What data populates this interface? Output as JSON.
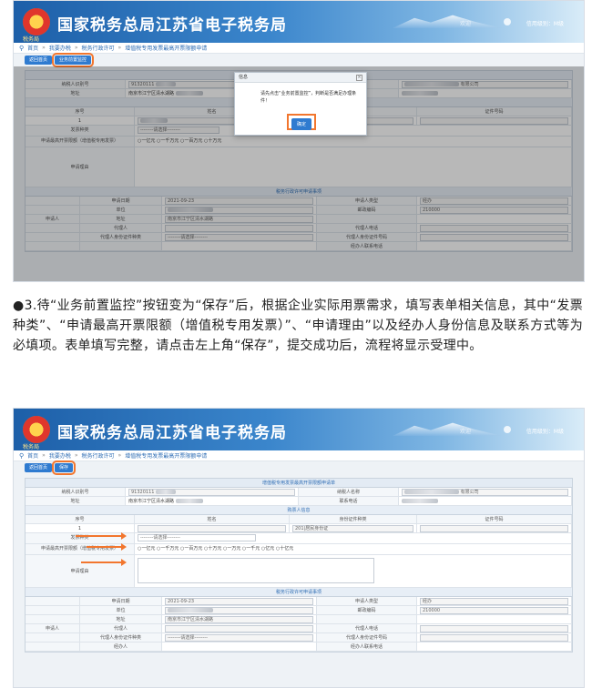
{
  "header": {
    "title": "国家税务总局江苏省电子税务局",
    "subtitle": "税务局",
    "welcome": "欢迎",
    "user": "信用级别：M级"
  },
  "breadcrumb": [
    "首页",
    "我要办税",
    "税务行政许可",
    "增值税专用发票最高开票限额申请"
  ],
  "screenshot1": {
    "toolbar": {
      "back": "返回首页",
      "pre_monitor": "业务前置监控"
    },
    "form_title": "增值税专用发票最高开票限额申请单",
    "taxpayer_id_label": "纳税人识别号",
    "taxpayer_id_value": "91320111",
    "taxpayer_name_label": "纳税人名称",
    "taxpayer_name_suffix": "有限公司",
    "address_label": "地址",
    "address_value": "南京市江宁区清水湖路",
    "phone_label": "联系电话",
    "agent_section": "购票人信息",
    "col_seq": "序号",
    "col_name": "姓名",
    "col_idtype": "身份证件种类",
    "col_idno": "证件号码",
    "row_seq": "1",
    "row_idtype": "201|居民身份证",
    "invoice_type_label": "发票种类",
    "invoice_type_value": "--------请选择--------",
    "limit_label": "申请最高开票限额（增值税专用发票）",
    "limit_options": [
      "一亿元",
      "一千万元",
      "一百万元",
      "十万元"
    ],
    "reason_label": "申请理由",
    "review_section": "税务行政许可申请事项",
    "apply_date_label": "申请日期",
    "apply_date_value": "2021-09-23",
    "unit_label": "单位",
    "addr2_label": "地址",
    "addr2_value": "南京市江宁区清水湖路",
    "applicant_label": "申请人",
    "agent_label": "代理人",
    "agent_idtype_label": "代理人身份证件种类",
    "agent_idtype_value": "--------请选择--------",
    "applicant_type_label": "申请人类型",
    "applicant_type_value": "经办",
    "postcode_label": "邮政编码",
    "postcode_value": "210000",
    "agent_phone_label": "代理人电话",
    "agent_idno_label": "代理人身份证件号码",
    "handler_phone_label": "经办人联系电话"
  },
  "dialog": {
    "title": "信息",
    "close": "×",
    "message": "请先点击“业务前置监控”，判断是否满足办理条件！",
    "ok": "确定"
  },
  "instruction": "●3.待“业务前置监控”按钮变为“保存”后，根据企业实际用票需求，填写表单相关信息，其中“发票种类”、“申请最高开票限额（增值税专用发票）”、“申请理由”以及经办人身份信息及联系方式等为必填项。表单填写完整，请点击左上角“保存”，提交成功后，流程将显示受理中。",
  "screenshot2": {
    "toolbar": {
      "back": "返回首页",
      "save": "保存"
    },
    "limit_options": [
      "一亿元",
      "一千万元",
      "一百万元",
      "十万元",
      "一万元",
      "一千元",
      "亿元",
      "十亿元"
    ],
    "agent_phone_label": "代理人电话",
    "handler_label": "经办人"
  }
}
